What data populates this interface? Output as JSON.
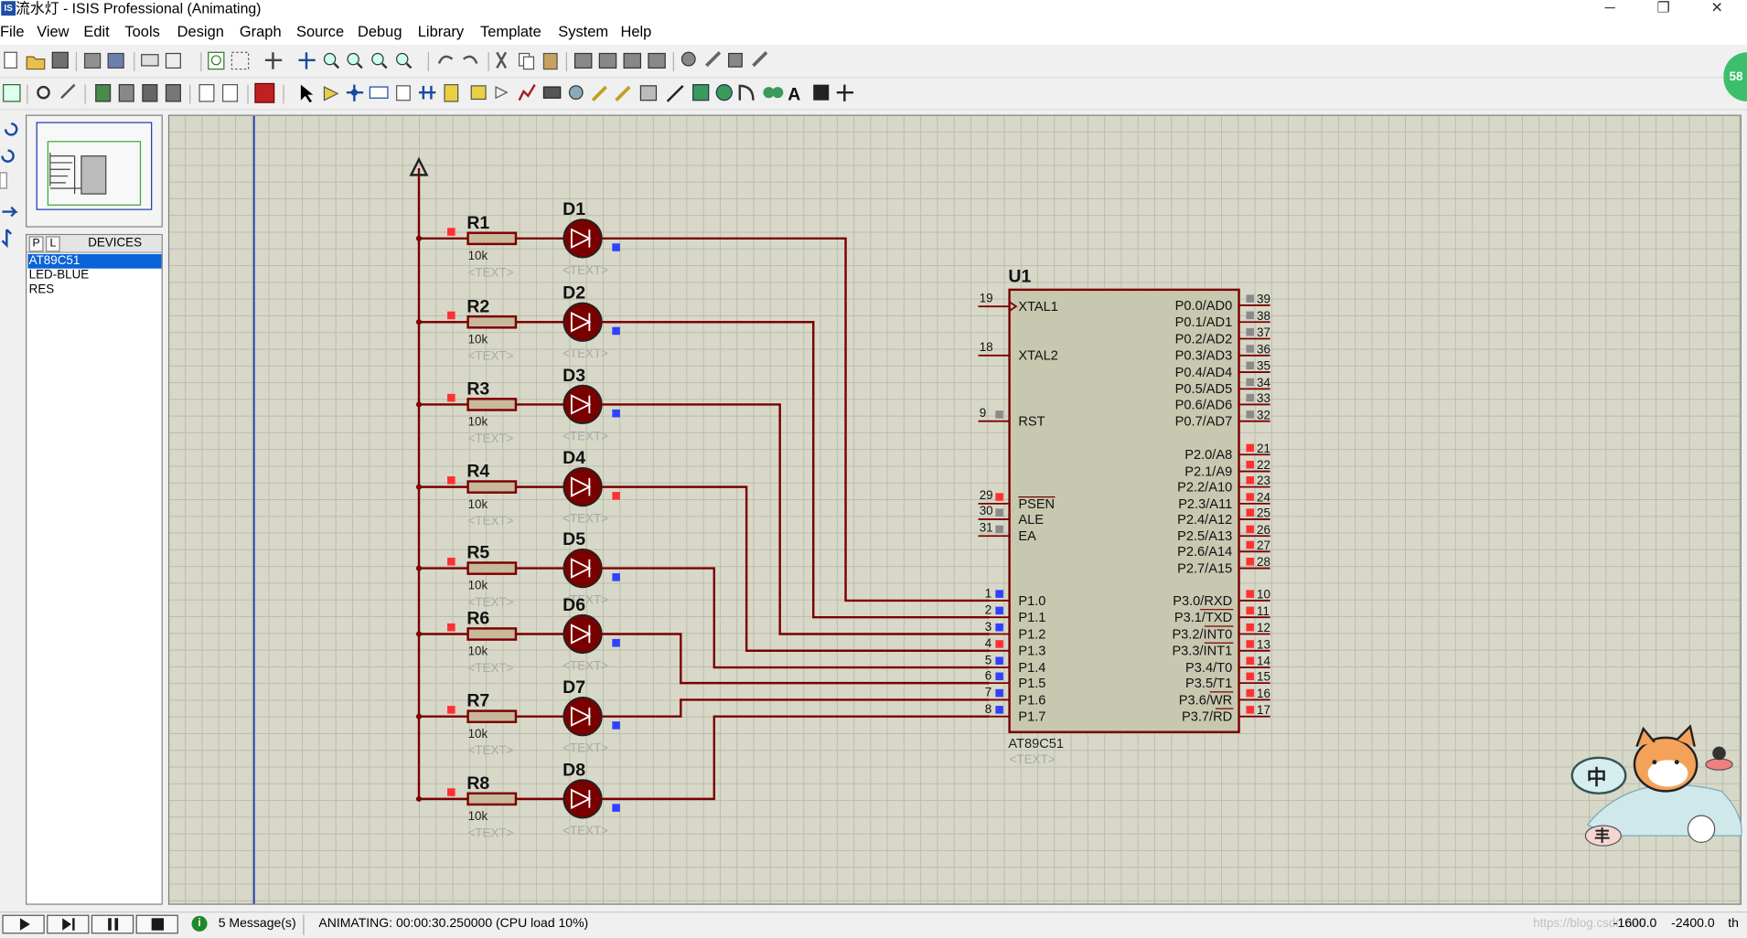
{
  "window": {
    "title": "流水灯 - ISIS Professional (Animating)",
    "app_icon_text": "IS",
    "minimize_glyph": "─",
    "restore_glyph": "❐",
    "close_glyph": "✕"
  },
  "menu": [
    "File",
    "View",
    "Edit",
    "Tools",
    "Design",
    "Graph",
    "Source",
    "Debug",
    "Library",
    "Template",
    "System",
    "Help"
  ],
  "devices_panel": {
    "tab_p": "P",
    "tab_l": "L",
    "header": "DEVICES",
    "items": [
      "AT89C51",
      "LED-BLUE",
      "RES"
    ],
    "selected_index": 0
  },
  "schematic": {
    "rows": [
      {
        "res": "R1",
        "val": "10k",
        "res_text": "<TEXT>",
        "led": "D1",
        "led_text": "<TEXT>"
      },
      {
        "res": "R2",
        "val": "10k",
        "res_text": "<TEXT>",
        "led": "D2",
        "led_text": "<TEXT>"
      },
      {
        "res": "R3",
        "val": "10k",
        "res_text": "<TEXT>",
        "led": "D3",
        "led_text": "<TEXT>"
      },
      {
        "res": "R4",
        "val": "10k",
        "res_text": "<TEXT>",
        "led": "D4",
        "led_text": "<TEXT>"
      },
      {
        "res": "R5",
        "val": "10k",
        "res_text": "<TEXT>",
        "led": "D5",
        "led_text": "<TEXT>"
      },
      {
        "res": "R6",
        "val": "10k",
        "res_text": "<TEXT>",
        "led": "D6",
        "led_text": "<TEXT>"
      },
      {
        "res": "R7",
        "val": "10k",
        "res_text": "<TEXT>",
        "led": "D7",
        "led_text": "<TEXT>"
      },
      {
        "res": "R8",
        "val": "10k",
        "res_text": "<TEXT>",
        "led": "D8",
        "led_text": "<TEXT>"
      }
    ],
    "chip": {
      "ref": "U1",
      "part": "AT89C51",
      "text": "<TEXT>",
      "left_top_pins": [
        {
          "num": "19",
          "name": "XTAL1"
        },
        {
          "num": "18",
          "name": "XTAL2"
        },
        {
          "num": "9",
          "name": "RST"
        }
      ],
      "left_mid_pins": [
        {
          "num": "29",
          "name": "PSEN"
        },
        {
          "num": "30",
          "name": "ALE"
        },
        {
          "num": "31",
          "name": "EA"
        }
      ],
      "port1_pins": [
        {
          "num": "1",
          "name": "P1.0"
        },
        {
          "num": "2",
          "name": "P1.1"
        },
        {
          "num": "3",
          "name": "P1.2"
        },
        {
          "num": "4",
          "name": "P1.3"
        },
        {
          "num": "5",
          "name": "P1.4"
        },
        {
          "num": "6",
          "name": "P1.5"
        },
        {
          "num": "7",
          "name": "P1.6"
        },
        {
          "num": "8",
          "name": "P1.7"
        }
      ],
      "port0_pins": [
        {
          "num": "39",
          "name": "P0.0/AD0"
        },
        {
          "num": "38",
          "name": "P0.1/AD1"
        },
        {
          "num": "37",
          "name": "P0.2/AD2"
        },
        {
          "num": "36",
          "name": "P0.3/AD3"
        },
        {
          "num": "35",
          "name": "P0.4/AD4"
        },
        {
          "num": "34",
          "name": "P0.5/AD5"
        },
        {
          "num": "33",
          "name": "P0.6/AD6"
        },
        {
          "num": "32",
          "name": "P0.7/AD7"
        }
      ],
      "port2_pins": [
        {
          "num": "21",
          "name": "P2.0/A8"
        },
        {
          "num": "22",
          "name": "P2.1/A9"
        },
        {
          "num": "23",
          "name": "P2.2/A10"
        },
        {
          "num": "24",
          "name": "P2.3/A11"
        },
        {
          "num": "25",
          "name": "P2.4/A12"
        },
        {
          "num": "26",
          "name": "P2.5/A13"
        },
        {
          "num": "27",
          "name": "P2.6/A14"
        },
        {
          "num": "28",
          "name": "P2.7/A15"
        }
      ],
      "port3_pins": [
        {
          "num": "10",
          "name": "P3.0/RXD"
        },
        {
          "num": "11",
          "name": "P3.1/TXD"
        },
        {
          "num": "12",
          "name": "P3.2/INT0"
        },
        {
          "num": "13",
          "name": "P3.3/INT1"
        },
        {
          "num": "14",
          "name": "P3.4/T0"
        },
        {
          "num": "15",
          "name": "P3.5/T1"
        },
        {
          "num": "16",
          "name": "P3.6/WR"
        },
        {
          "num": "17",
          "name": "P3.7/RD"
        }
      ]
    }
  },
  "status": {
    "messages": "5 Message(s)",
    "animating": "ANIMATING: 00:00:30.250000 (CPU load 10%)",
    "coord_x": "-1600.0",
    "coord_y": "-2400.0",
    "units": "th",
    "watermark": "https://blog.csdn.net/..."
  },
  "overlay": {
    "badge_text": "58",
    "mascot_char_top": "中",
    "mascot_char_bottom": "丰"
  },
  "colors": {
    "wire": "#7a0000",
    "chip_fill": "#c8c8b0",
    "led_body": "#7a0000",
    "high_pin": "#ff3030",
    "low_pin": "#3040ff",
    "canvas": "#d8d8c8",
    "selection": "#0a64d8"
  }
}
